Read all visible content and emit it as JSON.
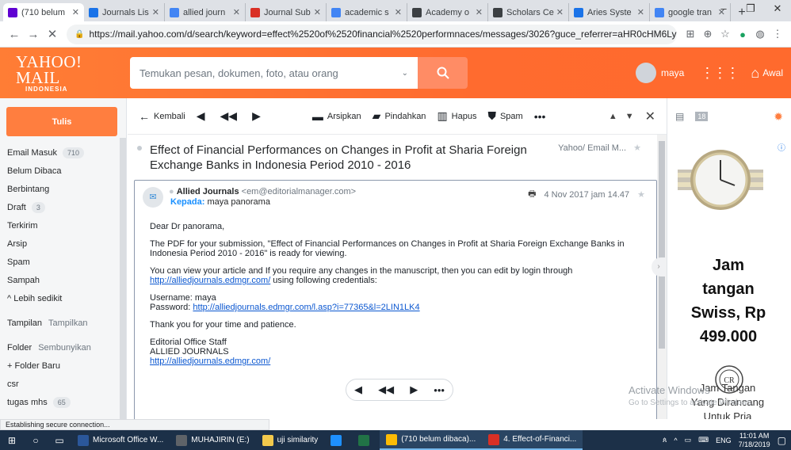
{
  "browser": {
    "tabs": [
      {
        "label": "(710 belum",
        "fav": "mail-favicon",
        "color": "#6001d2",
        "active": true
      },
      {
        "label": "Journals Lis",
        "fav": "journals-favicon",
        "color": "#1a73e8"
      },
      {
        "label": "allied journ",
        "fav": "google-favicon",
        "color": "#4285f4"
      },
      {
        "label": "Journal Sub",
        "fav": "journal-submit-favicon",
        "color": "#d93025"
      },
      {
        "label": "academic s",
        "fav": "google-favicon",
        "color": "#4285f4"
      },
      {
        "label": "Academy o",
        "fav": "academy-favicon",
        "color": "#3c4043"
      },
      {
        "label": "Scholars Ce",
        "fav": "scholars-favicon",
        "color": "#3c4043"
      },
      {
        "label": "Aries Syste",
        "fav": "aries-favicon",
        "color": "#1a73e8"
      },
      {
        "label": "google tran",
        "fav": "google-favicon",
        "color": "#4285f4"
      }
    ],
    "url": "https://mail.yahoo.com/d/search/keyword=effect%2520of%2520financial%2520performnaces/messages/3026?guce_referrer=aHR0cHM6Ly9sb2dpbi55YWhvby5..."
  },
  "yahoo": {
    "logo": "YAHOO! MAIL",
    "logo_sub": "INDONESIA",
    "search_placeholder": "Temukan pesan, dokumen, foto, atau orang",
    "user_name": "maya",
    "home_label": "Awal"
  },
  "sidebar": {
    "compose_label": "Tulis",
    "items": [
      {
        "label": "Email Masuk",
        "badge": "710"
      },
      {
        "label": "Belum Dibaca",
        "badge": ""
      },
      {
        "label": "Berbintang",
        "badge": ""
      },
      {
        "label": "Draft",
        "badge": "3"
      },
      {
        "label": "Terkirim",
        "badge": ""
      },
      {
        "label": "Arsip",
        "badge": ""
      },
      {
        "label": "Spam",
        "badge": ""
      },
      {
        "label": "Sampah",
        "badge": ""
      }
    ],
    "less_label": "^ Lebih sedikit",
    "views_label": "Tampilan",
    "views_action": "Tampilkan",
    "folders_label": "Folder",
    "folders_action": "Sembunyikan",
    "new_folder_label": "+ Folder Baru",
    "folders": [
      {
        "label": "csr",
        "badge": ""
      },
      {
        "label": "tugas mhs",
        "badge": "65"
      }
    ]
  },
  "toolbar": {
    "back_label": "Kembali",
    "archive_label": "Arsipkan",
    "move_label": "Pindahkan",
    "delete_label": "Hapus",
    "spam_label": "Spam"
  },
  "message": {
    "subject": "Effect of Financial Performances on Changes in Profit at Sharia Foreign Exchange Banks in Indonesia Period 2010 - 2016",
    "folder_info": "Yahoo/ Email M...",
    "sender_name": "Allied Journals",
    "sender_email": "<em@editorialmanager.com>",
    "to_label": "Kepada:",
    "to_name": "maya panorama",
    "date": "4 Nov 2017 jam 14.47",
    "greeting": "Dear Dr panorama,",
    "para1": "The PDF for your submission, \"Effect of Financial Performances on Changes in Profit at Sharia Foreign Exchange Banks in Indonesia Period 2010 - 2016\" is ready for viewing.",
    "para2": "You can view your article and If you require any changes in the manuscript, then you can edit by login through",
    "link1": "http://alliedjournals.edmgr.com/",
    "para2_tail": " using following credentials:",
    "username_line": "Username: maya",
    "password_label": "Password: ",
    "password_link": "http://alliedjournals.edmgr.com/l.asp?i=77365&l=2LIN1LK4",
    "thanks": "Thank you for your time and patience.",
    "sig1": "Editorial Office Staff",
    "sig2": "ALLIED JOURNALS",
    "sig_link": "http://alliedjournals.edmgr.com/"
  },
  "ad": {
    "line1": "Jam",
    "line2": "tangan",
    "line3": "Swiss, Rp",
    "line4": "499.000",
    "cap1": "Jam Tangan",
    "cap2": "Yang Dirancang",
    "cap3": "Untuk Pria",
    "logo_text": "CR",
    "badge_count": "18"
  },
  "watermark": {
    "line1": "Activate Windows",
    "line2": "Go to Settings to activate Windows."
  },
  "status_text": "Establishing secure connection...",
  "taskbar": {
    "apps": [
      {
        "label": "Microsoft Office W...",
        "color": "#2b579a",
        "open": false
      },
      {
        "label": "MUHAJIRIN (E:)",
        "color": "#5f6368",
        "open": false
      },
      {
        "label": "uji similarity",
        "color": "#f2c94c",
        "open": false
      },
      {
        "label": "",
        "color": "#1e90ff",
        "open": false
      },
      {
        "label": "",
        "color": "#217346",
        "open": false
      },
      {
        "label": "(710 belum dibaca)...",
        "color": "#fbbc05",
        "open": true
      },
      {
        "label": "4. Effect-of-Financi...",
        "color": "#d93025",
        "open": true
      }
    ],
    "lang": "ENG",
    "time": "11:01 AM",
    "date": "7/18/2019"
  }
}
